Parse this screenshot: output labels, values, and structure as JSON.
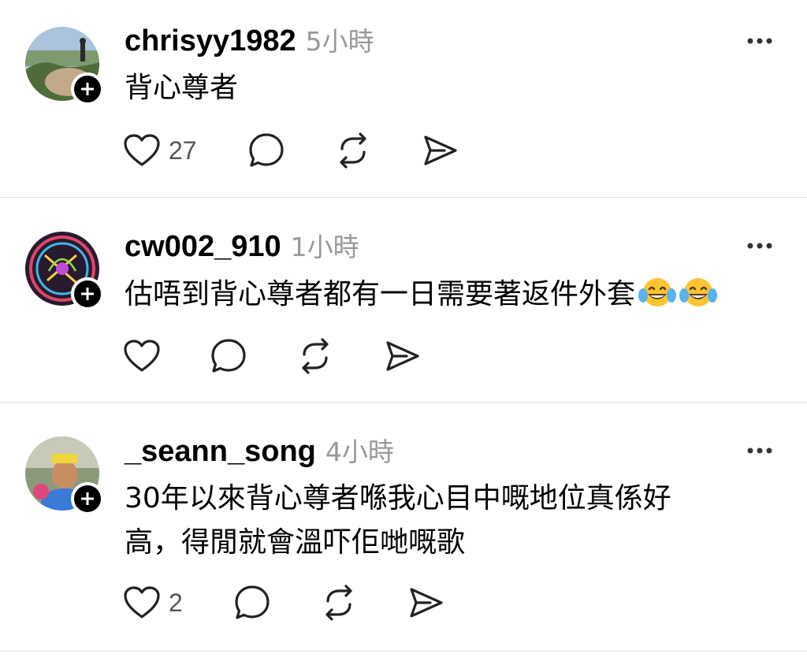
{
  "posts": [
    {
      "username": "chrisyy1982",
      "time": "5小時",
      "text": "背心尊者",
      "likes": "27"
    },
    {
      "username": "cw002_910",
      "time": "1小時",
      "text": "估唔到背心尊者都有一日需要著返件外套",
      "emoji": "face-with-tears-of-joy x2",
      "likes": ""
    },
    {
      "username": "_seann_song",
      "time": "4小時",
      "text_line1": "30年以來背心尊者喺我心目中嘅地位真係好",
      "text_line2": "高，得閒就會溫吓佢哋嘅歌",
      "likes": "2"
    }
  ],
  "icons": {
    "like": "heart-icon",
    "reply": "comment-bubble-icon",
    "repost": "repost-icon",
    "share": "send-icon",
    "more": "more-options-icon",
    "follow": "plus-icon"
  }
}
